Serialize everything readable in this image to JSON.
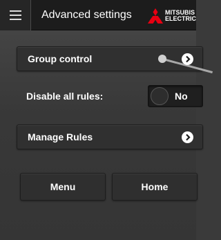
{
  "header": {
    "title": "Advanced settings",
    "menu_icon": "hamburger-icon",
    "logo": {
      "line1": "MITSUBIS",
      "line2": "ELECTRIC",
      "color": "#e60012"
    }
  },
  "group_control": {
    "label": "Group control",
    "icon": "chevron-right-icon"
  },
  "disable_rules": {
    "label": "Disable all rules:",
    "toggle_value": "No"
  },
  "manage_rules": {
    "label": "Manage Rules",
    "icon": "chevron-right-icon"
  },
  "footer": {
    "menu_label": "Menu",
    "home_label": "Home"
  }
}
